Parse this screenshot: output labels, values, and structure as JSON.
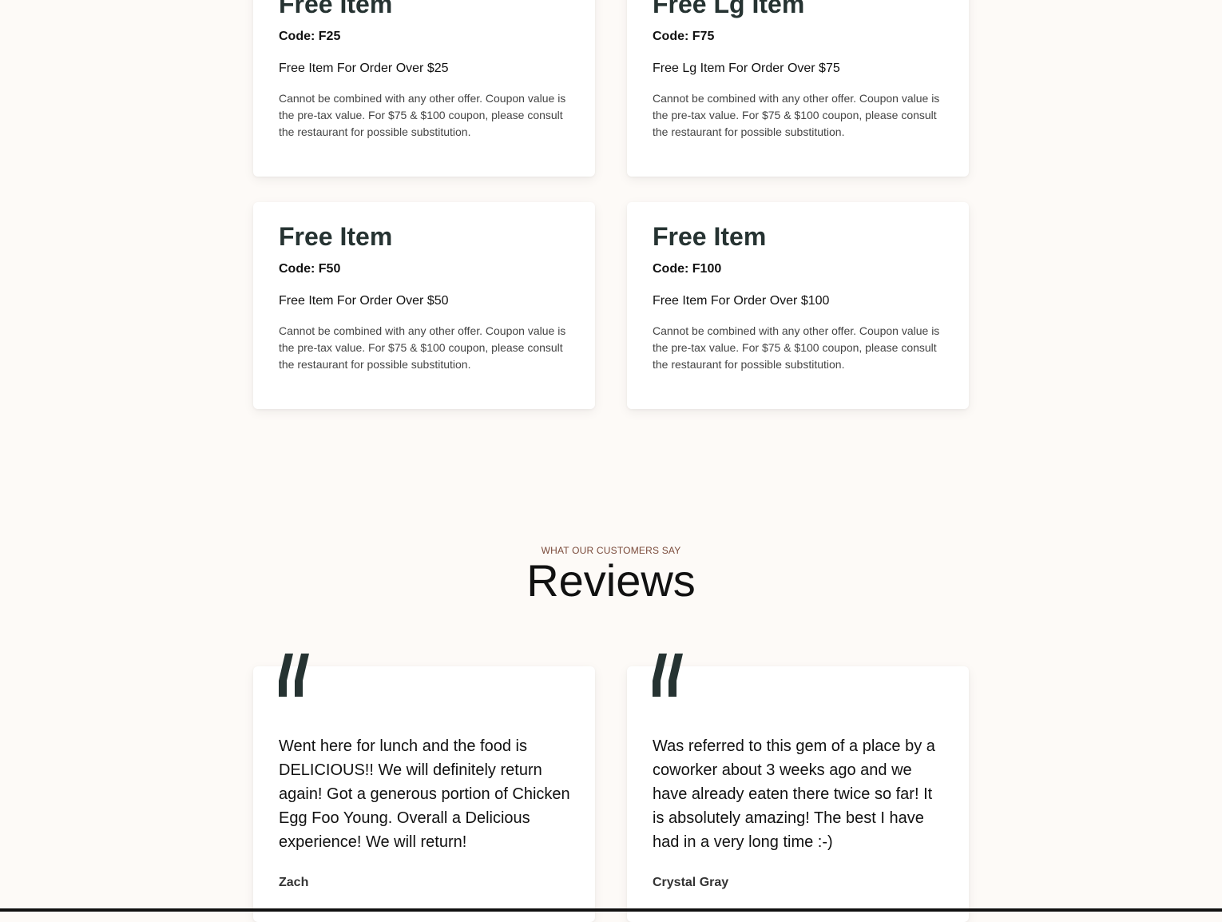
{
  "coupons": [
    {
      "title": "Free Item",
      "code": "Code: F25",
      "description": "Free Item For Order Over $25",
      "terms": "Cannot be combined with any other offer. Coupon value is the pre-tax value. For $75 & $100 coupon, please consult the restaurant for possible substitution."
    },
    {
      "title": "Free Lg Item",
      "code": "Code: F75",
      "description": "Free Lg Item For Order Over $75",
      "terms": "Cannot be combined with any other offer. Coupon value is the pre-tax value. For $75 & $100 coupon, please consult the restaurant for possible substitution."
    },
    {
      "title": "Free Item",
      "code": "Code: F50",
      "description": "Free Item For Order Over $50",
      "terms": "Cannot be combined with any other offer. Coupon value is the pre-tax value. For $75 & $100 coupon, please consult the restaurant for possible substitution."
    },
    {
      "title": "Free Item",
      "code": "Code: F100",
      "description": "Free Item For Order Over $100",
      "terms": "Cannot be combined with any other offer. Coupon value is the pre-tax value. For $75 & $100 coupon, please consult the restaurant for possible substitution."
    }
  ],
  "reviews_section": {
    "eyebrow": "WHAT OUR CUSTOMERS SAY",
    "title": "Reviews",
    "reviews": [
      {
        "text": "Went here for lunch and the food is DELICIOUS!! We will definitely return again! Got a generous portion of Chicken Egg Foo Young. Overall a Delicious experience! We will return!",
        "author": "Zach",
        "icon": "quote-icon"
      },
      {
        "text": "Was referred to this gem of a place by a coworker about 3 weeks ago and we have already eaten there twice so far! It is absolutely amazing! The best I have had in a very long time :-)",
        "author": "Crystal Gray",
        "icon": "quote-icon"
      }
    ]
  },
  "colors": {
    "background": "#fdfaf7",
    "card": "#ffffff",
    "heading": "#263332",
    "eyebrow": "#7a4a3a",
    "quote_mark": "#263332"
  }
}
